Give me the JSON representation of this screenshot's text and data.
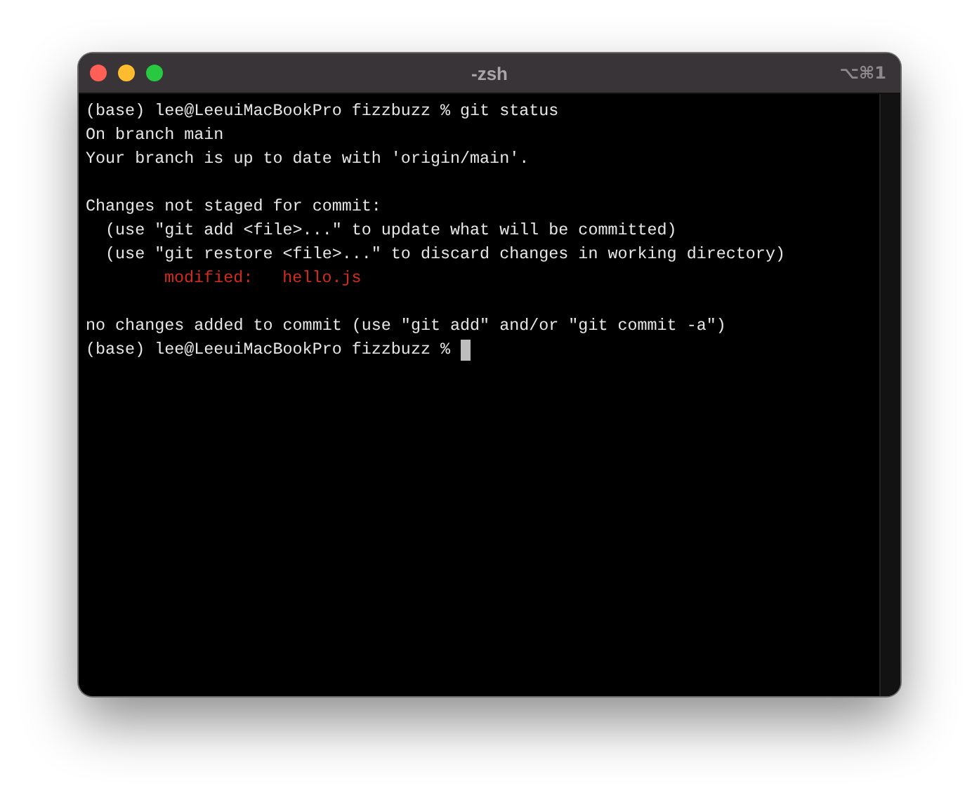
{
  "window": {
    "title": "-zsh",
    "shortcut": "⌥⌘1"
  },
  "lines": [
    {
      "kind": "text",
      "text": "(base) lee@LeeuiMacBookPro fizzbuzz % git status"
    },
    {
      "kind": "text",
      "text": "On branch main"
    },
    {
      "kind": "text",
      "text": "Your branch is up to date with 'origin/main'."
    },
    {
      "kind": "blank"
    },
    {
      "kind": "text",
      "text": "Changes not staged for commit:"
    },
    {
      "kind": "text",
      "text": "  (use \"git add <file>...\" to update what will be committed)"
    },
    {
      "kind": "text",
      "text": "  (use \"git restore <file>...\" to discard changes in working directory)"
    },
    {
      "kind": "modified",
      "text": "modified:   hello.js"
    },
    {
      "kind": "blank"
    },
    {
      "kind": "text",
      "text": "no changes added to commit (use \"git add\" and/or \"git commit -a\")"
    },
    {
      "kind": "prompt",
      "text": "(base) lee@LeeuiMacBookPro fizzbuzz %"
    }
  ]
}
